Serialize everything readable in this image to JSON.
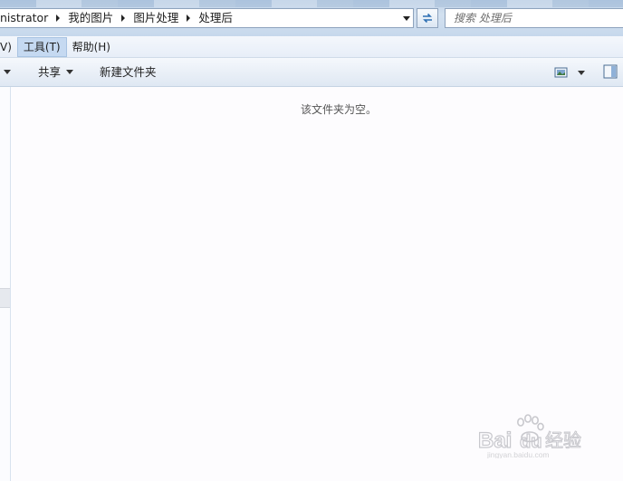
{
  "address_bar": {
    "breadcrumbs": [
      "nistrator",
      "我的图片",
      "图片处理",
      "处理后"
    ]
  },
  "search": {
    "placeholder": "搜索 处理后"
  },
  "menu": {
    "items": [
      "V)",
      "工具(T)",
      "帮助(H)"
    ],
    "active_index": 1
  },
  "command_bar": {
    "share_label": "共享",
    "new_folder_label": "新建文件夹"
  },
  "content": {
    "empty_message": "该文件夹为空。"
  },
  "watermark": {
    "text": "Baidu经验",
    "subtext": "jingyan.baidu.com"
  },
  "icons": {
    "breadcrumb_separator": "chevron-right-icon",
    "refresh": "refresh-icon",
    "view": "view-options-icon",
    "preview": "preview-pane-icon"
  },
  "colors": {
    "menu_active_bg": "#c5d9f1",
    "toolbar_bg": "#e9eff7",
    "content_bg": "#fdfcfe"
  }
}
